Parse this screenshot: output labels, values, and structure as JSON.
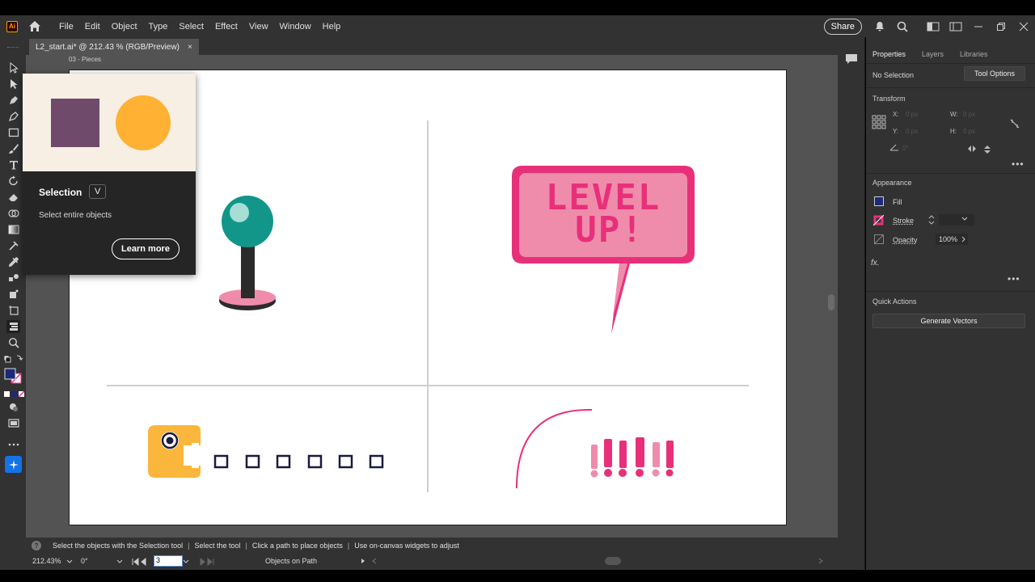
{
  "app": {
    "logo_text": "Ai",
    "menu": [
      "File",
      "Edit",
      "Object",
      "Type",
      "Select",
      "Effect",
      "View",
      "Window",
      "Help"
    ],
    "share_label": "Share"
  },
  "document": {
    "tab_title": "L2_start.ai* @ 212.43 % (RGB/Preview)",
    "tab_close": "×",
    "artboard_name": "03 - Pieces"
  },
  "tooltip": {
    "title": "Selection",
    "shortcut": "V",
    "description": "Select entire objects",
    "learn_more": "Learn more",
    "colors": {
      "square": "#6f4a6b",
      "circle": "#ffb133",
      "background": "#f7efe3"
    }
  },
  "artwork": {
    "speech_text_line1": "LEVEL",
    "speech_text_line2": "UP!",
    "exclaims": "!!!!!!",
    "colors": {
      "pink": "#e8307a",
      "light_pink": "#f08cab",
      "teal": "#12968a",
      "yellow": "#fbb63c",
      "navy": "#1a1a40"
    }
  },
  "properties_panel": {
    "tabs": [
      "Properties",
      "Layers",
      "Libraries"
    ],
    "active_tab": "Properties",
    "no_selection": "No Selection",
    "tool_options": "Tool Options",
    "transform_title": "Transform",
    "x_label": "X:",
    "y_label": "Y:",
    "w_label": "W:",
    "h_label": "H:",
    "x_val": "0 px",
    "y_val": "0 px",
    "w_val": "0 px",
    "h_val": "0 px",
    "angle_val": "0°",
    "appearance_title": "Appearance",
    "fill_label": "Fill",
    "stroke_label": "Stroke",
    "opacity_label": "Opacity",
    "opacity_value": "100%",
    "fx_label": "fx.",
    "quick_actions_title": "Quick Actions",
    "generate_vectors": "Generate Vectors",
    "more": "•••"
  },
  "hint_bar": {
    "help": "?",
    "items": [
      "Select the objects with the Selection tool",
      "Select the tool",
      "Click a path to place objects",
      "Use on-canvas widgets to adjust"
    ],
    "bold_prefixes": [
      "",
      "Select",
      "Click",
      "Use"
    ]
  },
  "status_bar": {
    "zoom": "212.43%",
    "rotation": "0°",
    "artboard_number": "3",
    "tool_name": "Objects on Path"
  }
}
